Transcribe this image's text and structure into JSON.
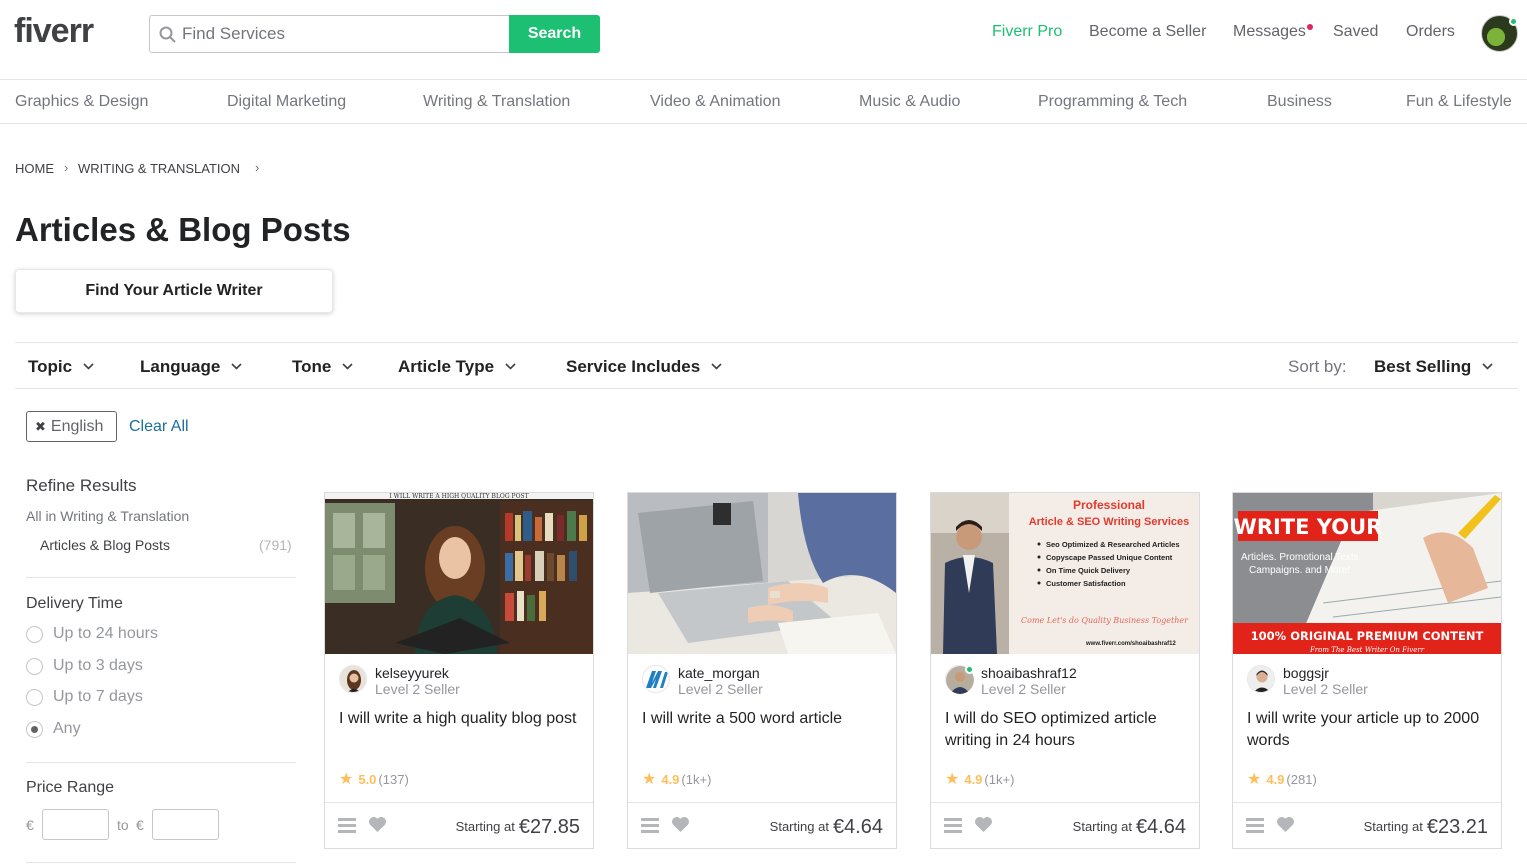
{
  "header": {
    "logo": "fiverr",
    "search_placeholder": "Find Services",
    "search_button": "Search",
    "nav": {
      "pro": "Fiverr Pro",
      "seller": "Become a Seller",
      "messages": "Messages",
      "saved": "Saved",
      "orders": "Orders"
    }
  },
  "categories": [
    "Graphics & Design",
    "Digital Marketing",
    "Writing & Translation",
    "Video & Animation",
    "Music & Audio",
    "Programming & Tech",
    "Business",
    "Fun & Lifestyle"
  ],
  "breadcrumb": [
    "HOME",
    "WRITING & TRANSLATION"
  ],
  "page_title": "Articles & Blog Posts",
  "find_writer_button": "Find Your Article Writer",
  "filters": [
    "Topic",
    "Language",
    "Tone",
    "Article Type",
    "Service Includes"
  ],
  "sort": {
    "label": "Sort by:",
    "value": "Best Selling"
  },
  "active_tag": "English",
  "clear_all": "Clear All",
  "sidebar": {
    "refine_title": "Refine Results",
    "all_in": "All in Writing & Translation",
    "current_item": "Articles & Blog Posts",
    "current_count": "(791)",
    "delivery_title": "Delivery Time",
    "delivery_options": [
      {
        "label": "Up to 24 hours",
        "selected": false
      },
      {
        "label": "Up to 3 days",
        "selected": false
      },
      {
        "label": "Up to 7 days",
        "selected": false
      },
      {
        "label": "Any",
        "selected": true
      }
    ],
    "price_title": "Price Range",
    "currency": "€",
    "to_label": "to",
    "price_min": "",
    "price_max": ""
  },
  "gigs": [
    {
      "seller": "kelseyyurek",
      "level": "Level 2 Seller",
      "title": "I will write a high quality blog post",
      "score": "5.0",
      "count": "(137)",
      "starting_label": "Starting at",
      "price": "€27.85",
      "image_caption": "I WILL WRITE A HIGH QUALITY BLOG POST"
    },
    {
      "seller": "kate_morgan",
      "level": "Level 2 Seller",
      "title": "I will write a 500 word article",
      "score": "4.9",
      "count": "(1k+)",
      "starting_label": "Starting at",
      "price": "€4.64"
    },
    {
      "seller": "shoaibashraf12",
      "level": "Level 2 Seller",
      "title": "I will do SEO optimized article writing in 24 hours",
      "score": "4.9",
      "count": "(1k+)",
      "starting_label": "Starting at",
      "price": "€4.64",
      "image_heading1": "Professional",
      "image_heading2": "Article & SEO Writing Services",
      "image_bullets": [
        "Seo Optimized & Researched Articles",
        "Copyscape Passed Unique Content",
        "On Time Quick Delivery",
        "Customer Satisfaction"
      ],
      "image_tagline": "Come Let's do Quality Business Together",
      "image_url_text": "www.fiverr.com/shoaibashraf12"
    },
    {
      "seller": "boggsjr",
      "level": "Level 2 Seller",
      "title": "I will write your article up to 2000 words",
      "score": "4.9",
      "count": "(281)",
      "starting_label": "Starting at",
      "price": "€23.21",
      "image_heading": "WRITE YOUR",
      "image_sub1": "Articles. Promotional Texts.",
      "image_sub2": "Campaigns. and More!",
      "image_banner": "100% ORIGINAL PREMIUM CONTENT",
      "image_banner_sub": "From The Best Writer On Fiverr"
    }
  ],
  "colors": {
    "brand_green": "#1dbf73",
    "star": "#ffbe5b",
    "link": "#1c6f9e",
    "notify": "#e0245e"
  }
}
